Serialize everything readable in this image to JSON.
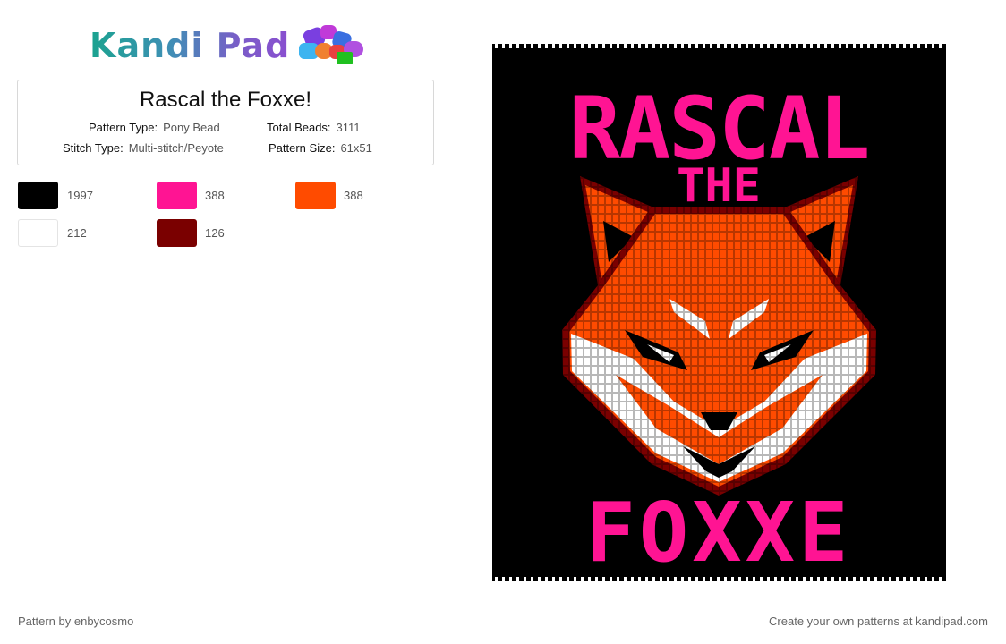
{
  "brand": {
    "name": "Kandi Pad",
    "icon": "bead-pile-icon"
  },
  "pattern": {
    "title": "Rascal the Foxxe!",
    "pattern_type_label": "Pattern Type:",
    "pattern_type": "Pony Bead",
    "total_beads_label": "Total Beads:",
    "total_beads": "3111",
    "stitch_type_label": "Stitch Type:",
    "stitch_type": "Multi-stitch/Peyote",
    "pattern_size_label": "Pattern Size:",
    "pattern_size": "61x51"
  },
  "colors": [
    {
      "hex": "#000000",
      "count": "1997"
    },
    {
      "hex": "#ff1493",
      "count": "388"
    },
    {
      "hex": "#ff4b00",
      "count": "388"
    },
    {
      "hex": "#ffffff",
      "count": "212"
    },
    {
      "hex": "#7a0000",
      "count": "126"
    }
  ],
  "image": {
    "line1": "RASCAL",
    "line2": "THE",
    "line3": "FOXXE"
  },
  "footer": {
    "author": "Pattern by enbycosmo",
    "cta": "Create your own patterns at kandipad.com"
  }
}
